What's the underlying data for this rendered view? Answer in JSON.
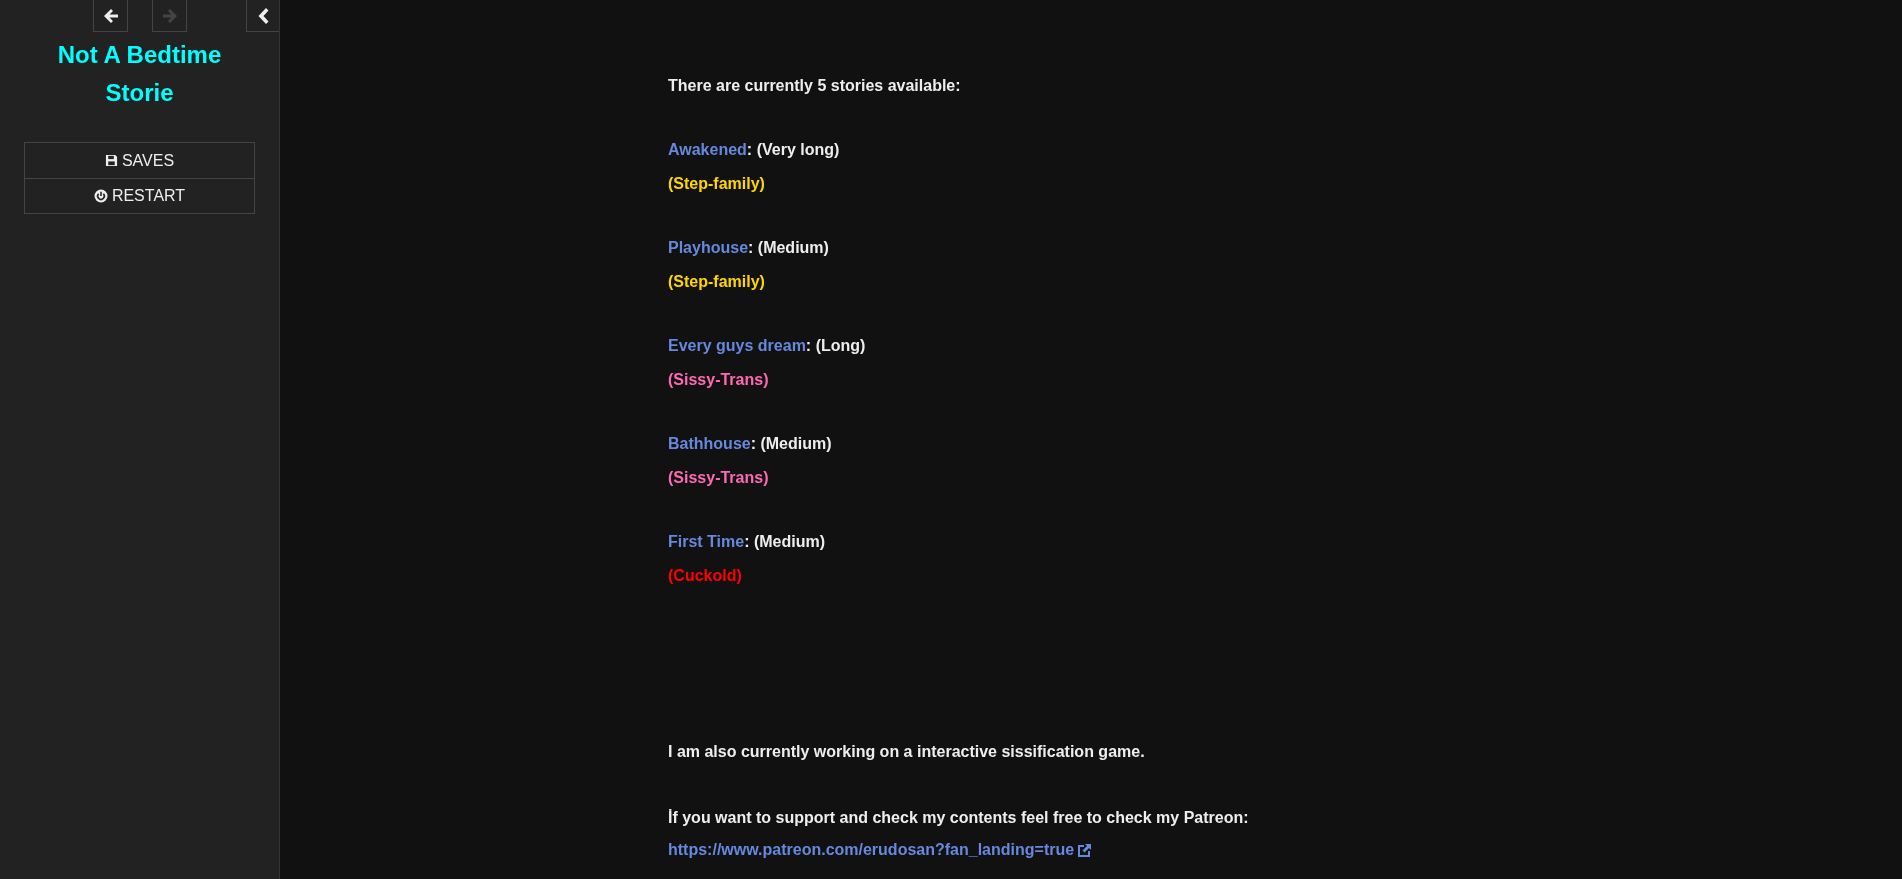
{
  "sidebar": {
    "history": [
      {
        "kind": "back",
        "disabled": false
      },
      {
        "kind": "forward",
        "disabled": true
      }
    ],
    "title": "Not A Bedtime Storie",
    "menu": [
      {
        "kind": "saves",
        "label": "SAVES"
      },
      {
        "kind": "restart",
        "label": "RESTART"
      }
    ]
  },
  "passage": {
    "intro": "There are currently 5 stories available:",
    "stories": [
      {
        "title": "Awakened",
        "length": ": (Very long)",
        "tag": "(Step-family)",
        "color": "#ffd700"
      },
      {
        "title": "Playhouse",
        "length": ": (Medium)",
        "tag": "(Step-family)",
        "color": "#ffd700"
      },
      {
        "title": "Every guys dream",
        "length": ": (Long)",
        "tag": "(Sissy-Trans)",
        "color": "#ff69b4"
      },
      {
        "title": "Bathhouse",
        "length": ": (Medium)",
        "tag": "(Sissy-Trans)",
        "color": "#ff69b4"
      },
      {
        "title": "First Time",
        "length": ": (Medium)",
        "tag": "(Cuckold)",
        "color": "#ff0000"
      }
    ],
    "note": "I am also currently working on a interactive sissification game.",
    "support": "İf you want to support and check my contents feel free to check my Patreon:",
    "link": "https://www.patreon.com/erudosan?fan_landing=true"
  }
}
